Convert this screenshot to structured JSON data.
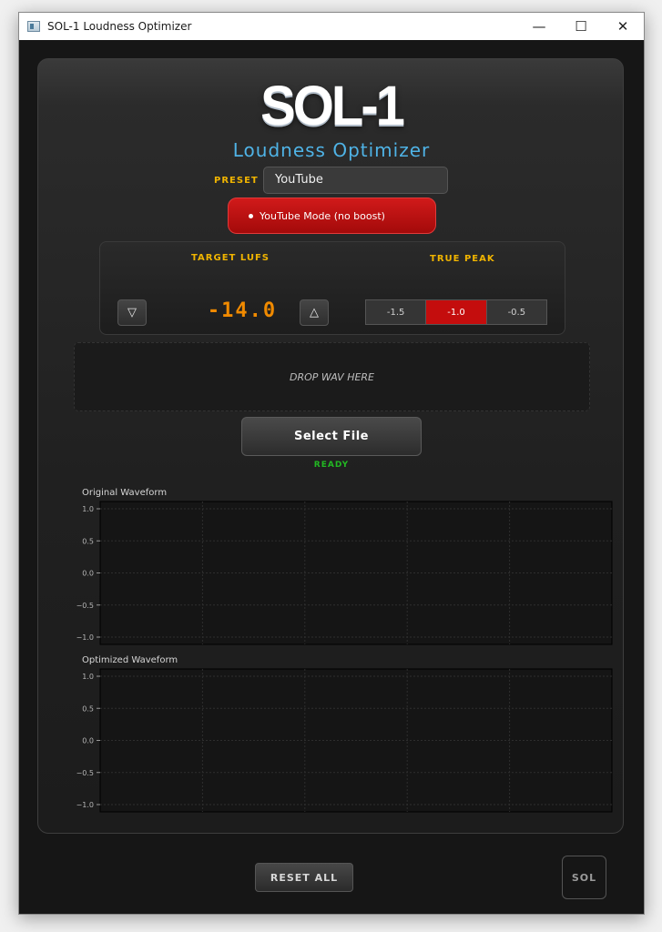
{
  "window": {
    "title": "SOL-1 Loudness Optimizer",
    "controls": {
      "minimize": "—",
      "maximize": "☐",
      "close": "✕"
    }
  },
  "header": {
    "logo": "SOL-1",
    "subtitle": "Loudness Optimizer"
  },
  "preset": {
    "label": "PRESET",
    "value": "YouTube"
  },
  "mode": {
    "badge": "YouTube Mode  (no boost)"
  },
  "target": {
    "label": "TARGET LUFS",
    "value": "-14.0",
    "down": "▽",
    "up": "△"
  },
  "true_peak": {
    "label": "TRUE PEAK",
    "options": [
      "-1.5",
      "-1.0",
      "-0.5"
    ],
    "selected": "-1.0"
  },
  "drop_zone": {
    "text": "DROP WAV HERE"
  },
  "select_file": {
    "label": "Select File"
  },
  "status": {
    "text": "READY",
    "color": "#22b822"
  },
  "charts": {
    "original": {
      "title": "Original Waveform"
    },
    "optimized": {
      "title": "Optimized Waveform"
    }
  },
  "chart_data": [
    {
      "type": "line",
      "title": "Original Waveform",
      "y_ticks": [
        "1.0",
        "0.5",
        "0.0",
        "−0.5",
        "−1.0"
      ],
      "ylim": [
        -1.0,
        1.0
      ],
      "grid": true,
      "series": []
    },
    {
      "type": "line",
      "title": "Optimized Waveform",
      "y_ticks": [
        "1.0",
        "0.5",
        "0.0",
        "−0.5",
        "−1.0"
      ],
      "ylim": [
        -1.0,
        1.0
      ],
      "grid": true,
      "series": []
    }
  ],
  "footer": {
    "reset": "RESET ALL",
    "badge": "SOL"
  },
  "colors": {
    "accent": "#4fb3e6",
    "label": "#f0b400",
    "lufs": "#f08a00",
    "active_red": "#c40d0d"
  }
}
